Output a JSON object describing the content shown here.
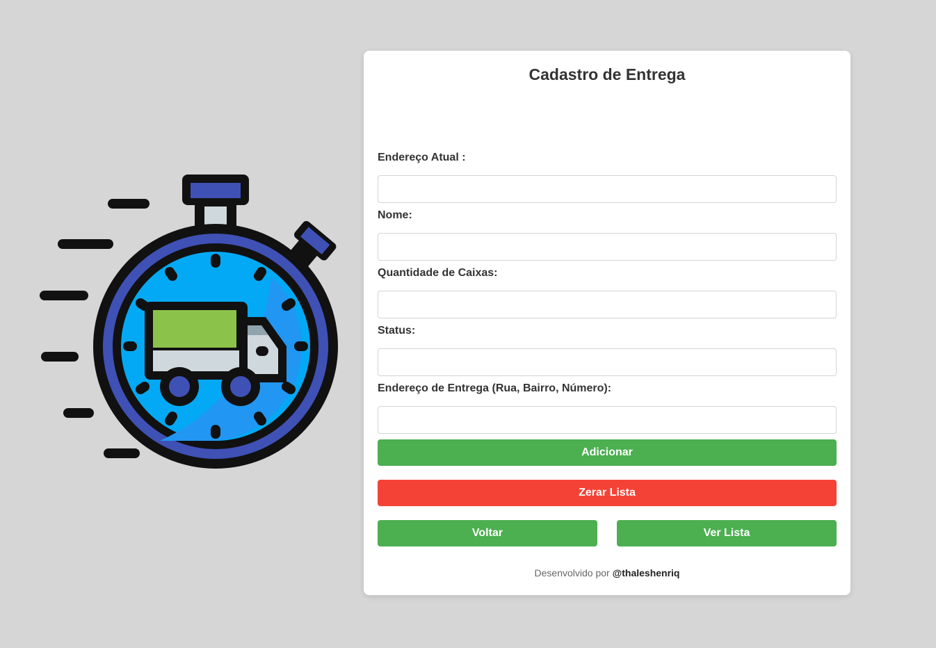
{
  "form": {
    "title": "Cadastro de Entrega",
    "fields": [
      {
        "label": "Endereço Atual :",
        "value": "",
        "placeholder": ""
      },
      {
        "label": "Nome:",
        "value": "",
        "placeholder": ""
      },
      {
        "label": "Quantidade de Caixas:",
        "value": "",
        "placeholder": ""
      },
      {
        "label": "Status:",
        "value": "",
        "placeholder": ""
      },
      {
        "label": "Endereço de Entrega (Rua, Bairro, Número):",
        "value": "",
        "placeholder": ""
      }
    ],
    "buttons": {
      "add": "Adicionar",
      "clear": "Zerar Lista",
      "back": "Voltar",
      "view": "Ver Lista"
    }
  },
  "footer": {
    "prefix": "Desenvolvido por",
    "author": "@thaleshenriq"
  },
  "illustration": {
    "icon": "delivery-stopwatch-truck-icon"
  },
  "colors": {
    "background": "#d6d6d6",
    "primary_button": "#4caf50",
    "danger_button": "#f44336",
    "card": "#ffffff"
  }
}
